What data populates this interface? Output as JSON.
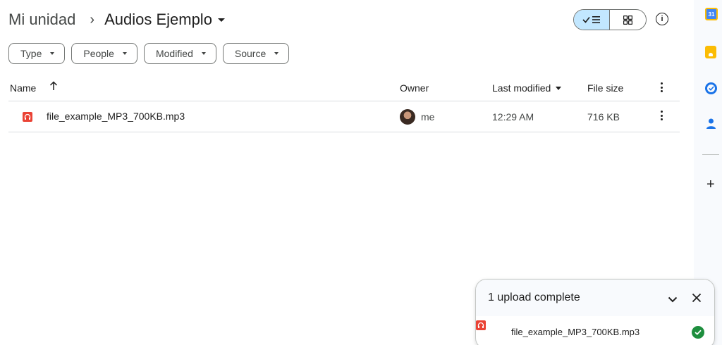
{
  "breadcrumb": {
    "root": "Mi unidad",
    "separator": "›",
    "current": "Audios Ejemplo"
  },
  "view_toggle": {
    "list_icon": "check-list-icon",
    "grid_icon": "grid-icon",
    "active": "list"
  },
  "info_icon": "info-icon",
  "filters": [
    {
      "label": "Type"
    },
    {
      "label": "People"
    },
    {
      "label": "Modified"
    },
    {
      "label": "Source"
    }
  ],
  "table": {
    "headers": {
      "name": "Name",
      "owner": "Owner",
      "modified": "Last modified",
      "size": "File size"
    },
    "rows": [
      {
        "name": "file_example_MP3_700KB.mp3",
        "owner": "me",
        "modified": "12:29 AM",
        "size": "716 KB",
        "icon": "audio-file-icon"
      }
    ]
  },
  "side_panel": {
    "calendar_day": "31",
    "icons": [
      "calendar-icon",
      "keep-icon",
      "tasks-icon",
      "contacts-icon",
      "add-icon"
    ]
  },
  "upload": {
    "title": "1 upload complete",
    "file": "file_example_MP3_700KB.mp3",
    "status_icon": "check-circle-icon"
  },
  "colors": {
    "accent": "#c2e7ff",
    "file_red": "#ea4335",
    "success": "#1e8e3e"
  }
}
